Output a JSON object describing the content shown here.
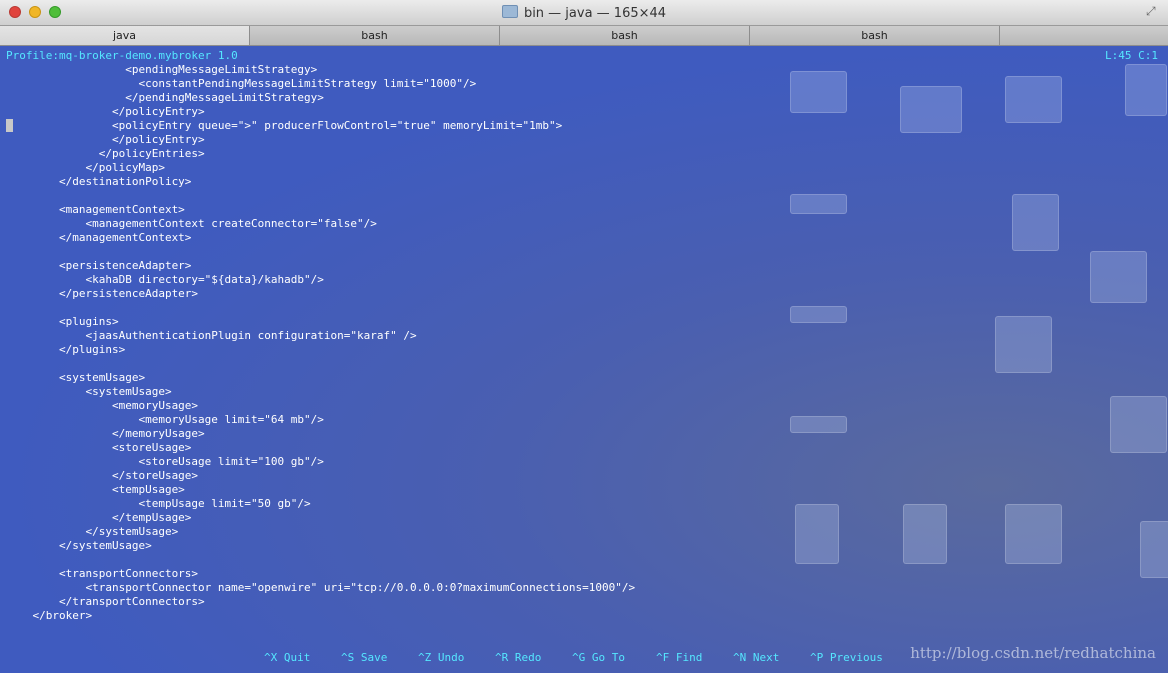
{
  "window": {
    "title": "bin — java — 165×44"
  },
  "tabs": [
    {
      "label": "java",
      "active": true
    },
    {
      "label": "bash",
      "active": false
    },
    {
      "label": "bash",
      "active": false
    },
    {
      "label": "bash",
      "active": false
    }
  ],
  "editor": {
    "profile": "Profile:mq-broker-demo.mybroker 1.0",
    "position": "L:45 C:1",
    "lines": [
      "                  <pendingMessageLimitStrategy>",
      "                    <constantPendingMessageLimitStrategy limit=\"1000\"/>",
      "                  </pendingMessageLimitStrategy>",
      "                </policyEntry>",
      "                <policyEntry queue=\">\" producerFlowControl=\"true\" memoryLimit=\"1mb\">",
      "                </policyEntry>",
      "              </policyEntries>",
      "            </policyMap>",
      "        </destinationPolicy>",
      "",
      "        <managementContext>",
      "            <managementContext createConnector=\"false\"/>",
      "        </managementContext>",
      "",
      "        <persistenceAdapter>",
      "            <kahaDB directory=\"${data}/kahadb\"/>",
      "        </persistenceAdapter>",
      "",
      "        <plugins>",
      "            <jaasAuthenticationPlugin configuration=\"karaf\" />",
      "        </plugins>",
      "",
      "        <systemUsage>",
      "            <systemUsage>",
      "                <memoryUsage>",
      "                    <memoryUsage limit=\"64 mb\"/>",
      "                </memoryUsage>",
      "                <storeUsage>",
      "                    <storeUsage limit=\"100 gb\"/>",
      "                </storeUsage>",
      "                <tempUsage>",
      "                    <tempUsage limit=\"50 gb\"/>",
      "                </tempUsage>",
      "            </systemUsage>",
      "        </systemUsage>",
      "",
      "        <transportConnectors>",
      "            <transportConnector name=\"openwire\" uri=\"tcp://0.0.0.0:0?maximumConnections=1000\"/>",
      "        </transportConnectors>",
      "    </broker>"
    ],
    "shortcuts": [
      {
        "key": "^X",
        "label": "Quit"
      },
      {
        "key": "^S",
        "label": "Save"
      },
      {
        "key": "^Z",
        "label": "Undo"
      },
      {
        "key": "^R",
        "label": "Redo"
      },
      {
        "key": "^G",
        "label": "Go To"
      },
      {
        "key": "^F",
        "label": "Find"
      },
      {
        "key": "^N",
        "label": "Next"
      },
      {
        "key": "^P",
        "label": "Previous"
      }
    ]
  },
  "watermark": "http://blog.csdn.net/redhatchina",
  "colors": {
    "terminal_bg": "#3f5bbf",
    "status_text": "#55e7ff",
    "code_text": "#ffffff"
  }
}
